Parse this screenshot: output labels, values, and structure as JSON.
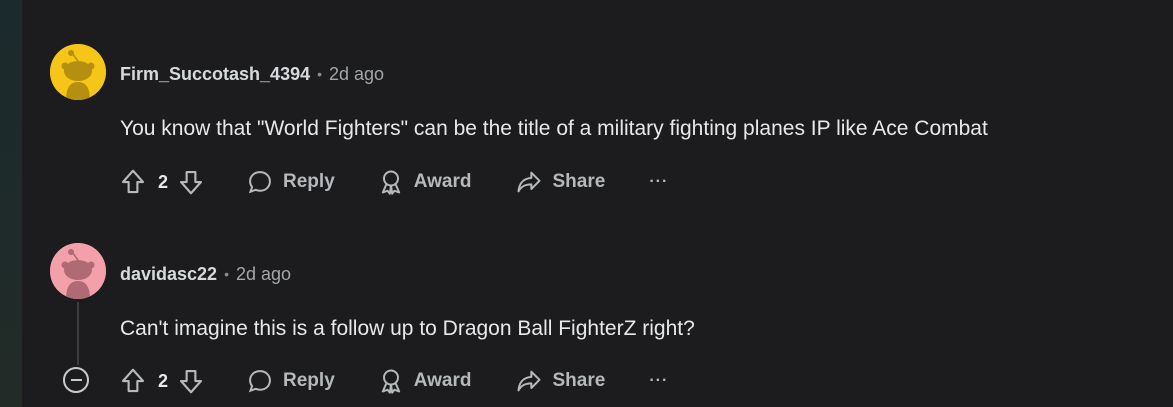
{
  "comments": [
    {
      "username": "Firm_Succotash_4394",
      "separator": "•",
      "timestamp": "2d ago",
      "text": "You know that \"World Fighters\" can be the title of a military fighting planes IP like Ace Combat",
      "score": "2",
      "reply_label": "Reply",
      "award_label": "Award",
      "share_label": "Share",
      "more_label": "···",
      "avatar_color": "#f5c518"
    },
    {
      "username": "davidasc22",
      "separator": "•",
      "timestamp": "2d ago",
      "text": "Can't imagine this is a follow up to Dragon Ball FighterZ right?",
      "score": "2",
      "reply_label": "Reply",
      "award_label": "Award",
      "share_label": "Share",
      "more_label": "···",
      "avatar_color": "#f2a0aa"
    }
  ],
  "colors": {
    "background": "#1c1c1e",
    "text": "#e6e8ea",
    "muted": "#a3a6a8"
  }
}
